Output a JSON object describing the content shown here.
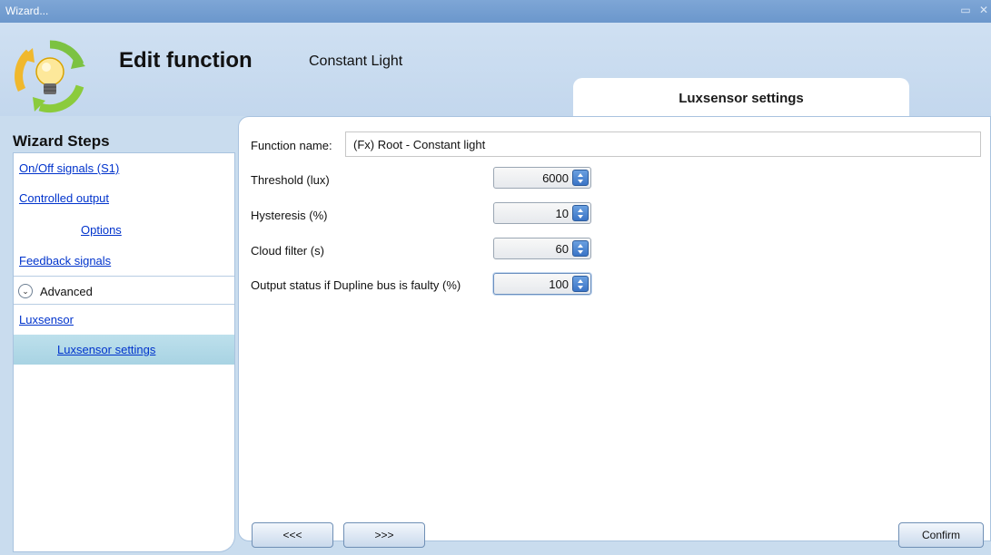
{
  "window": {
    "title": "Wizard...",
    "restore_glyph": "▭",
    "close_glyph": "✕"
  },
  "header": {
    "title": "Edit function",
    "subtitle": "Constant Light",
    "active_tab": "Luxsensor settings"
  },
  "sidebar": {
    "title": "Wizard Steps",
    "items": [
      {
        "label": "On/Off signals (S1)"
      },
      {
        "label": "Controlled output"
      },
      {
        "label": "Options"
      },
      {
        "label": "Feedback signals"
      },
      {
        "label": "Advanced"
      },
      {
        "label": "Luxsensor"
      },
      {
        "label": "Luxsensor settings"
      }
    ]
  },
  "form": {
    "function_name_label": "Function name:",
    "function_name_value": "(Fx) Root - Constant light",
    "fields": [
      {
        "label": "Threshold (lux)",
        "value": "6000"
      },
      {
        "label": "Hysteresis (%)",
        "value": "10"
      },
      {
        "label": "Cloud filter (s)",
        "value": "60"
      },
      {
        "label": "Output status if Dupline bus is faulty (%)",
        "value": "100"
      }
    ]
  },
  "footer": {
    "back_label": "<<<",
    "next_label": ">>>",
    "confirm_label": "Confirm"
  },
  "colors": {
    "titlebar": "#6b97cc",
    "header_bg": "#c9dcee",
    "link": "#0033cc",
    "selected": "#a8d3e3",
    "spin_button": "#3a74c6"
  }
}
